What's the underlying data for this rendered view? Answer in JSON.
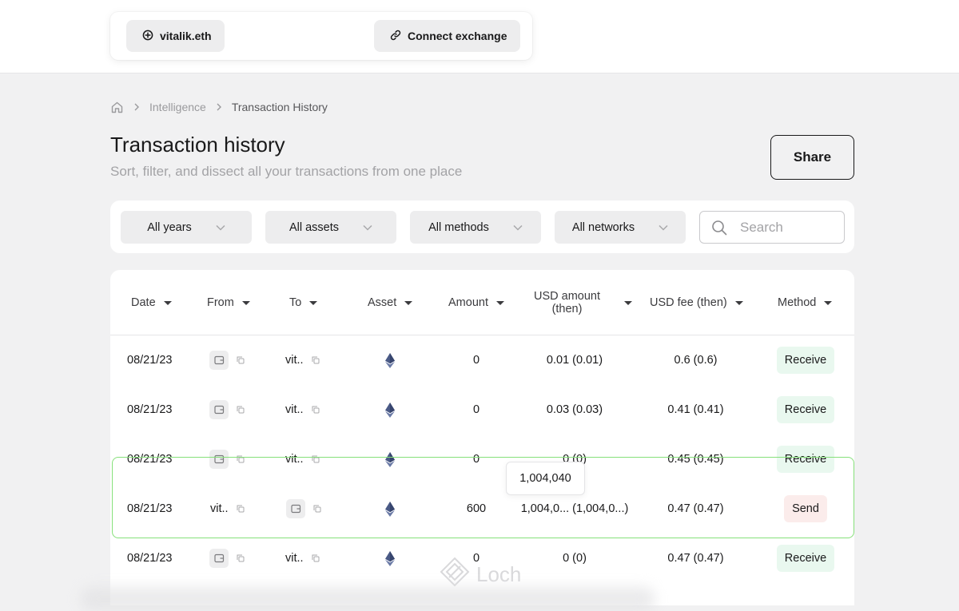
{
  "topbar": {
    "wallet_label": "vitalik.eth",
    "connect_label": "Connect exchange"
  },
  "breadcrumb": {
    "items": [
      "Intelligence",
      "Transaction History"
    ]
  },
  "header": {
    "title": "Transaction history",
    "subtitle": "Sort, filter, and dissect all your transactions from one place",
    "share_label": "Share"
  },
  "filters": {
    "years": "All years",
    "assets": "All assets",
    "methods": "All methods",
    "networks": "All networks",
    "search_placeholder": "Search"
  },
  "table": {
    "columns": {
      "date": "Date",
      "from": "From",
      "to": "To",
      "asset": "Asset",
      "amount": "Amount",
      "usd_amount_1": "USD amount",
      "usd_amount_2": "(then)",
      "usd_fee": "USD fee (then)",
      "method": "Method"
    },
    "rows": [
      {
        "date": "08/21/23",
        "from": "",
        "to": "vit..",
        "asset": "ETH",
        "amount": "0",
        "usd_amount": "0.01 (0.01)",
        "usd_fee": "0.6 (0.6)",
        "method": "Receive"
      },
      {
        "date": "08/21/23",
        "from": "",
        "to": "vit..",
        "asset": "ETH",
        "amount": "0",
        "usd_amount": "0.03 (0.03)",
        "usd_fee": "0.41 (0.41)",
        "method": "Receive"
      },
      {
        "date": "08/21/23",
        "from": "",
        "to": "vit..",
        "asset": "ETH",
        "amount": "0",
        "usd_amount": "0 (0)",
        "usd_fee": "0.45 (0.45)",
        "method": "Receive"
      },
      {
        "date": "08/21/23",
        "from": "vit..",
        "to": "",
        "asset": "ETH",
        "amount": "600",
        "usd_amount": "1,004,0... (1,004,0...)",
        "usd_fee": "0.47 (0.47)",
        "method": "Send"
      },
      {
        "date": "08/21/23",
        "from": "",
        "to": "vit..",
        "asset": "ETH",
        "amount": "0",
        "usd_amount": "0 (0)",
        "usd_fee": "0.47 (0.47)",
        "method": "Receive"
      }
    ],
    "tooltip": "1,004,040"
  },
  "watermark": "Loch",
  "colors": {
    "receive_badge": "#e9f8ef",
    "send_badge": "#fbeceb",
    "highlight_border": "#86e07a",
    "eth_icon": "#4a5a86"
  },
  "icons": {
    "home": "home-icon",
    "wallet": "wallet-icon",
    "copy": "copy-icon",
    "link": "link-icon",
    "search": "search-icon",
    "eth": "ethereum-icon"
  }
}
